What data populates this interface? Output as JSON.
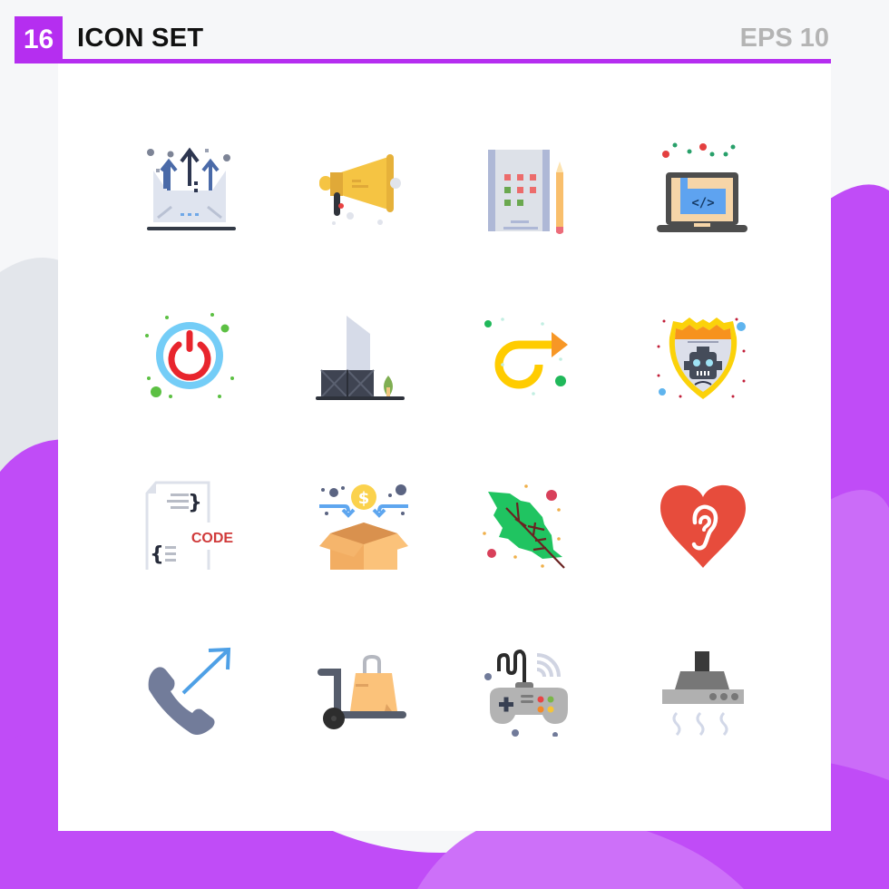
{
  "header": {
    "count": "16",
    "title": "ICON SET",
    "format": "EPS 10"
  },
  "colors": {
    "accent": "#b52ef0",
    "background_blob": "#c04cf7",
    "panel": "#ffffff"
  },
  "icons": [
    {
      "name": "email-upload-arrows",
      "row": 1,
      "col": 1
    },
    {
      "name": "megaphone",
      "row": 1,
      "col": 2
    },
    {
      "name": "sketchbook-pencil",
      "row": 1,
      "col": 3
    },
    {
      "name": "laptop-code",
      "row": 1,
      "col": 4
    },
    {
      "name": "power-button",
      "row": 2,
      "col": 1
    },
    {
      "name": "building-with-leaf",
      "row": 2,
      "col": 2
    },
    {
      "name": "loop-arrow",
      "row": 2,
      "col": 3
    },
    {
      "name": "robot-shield",
      "row": 2,
      "col": 4
    },
    {
      "name": "code-document",
      "row": 3,
      "col": 1,
      "label": "CODE"
    },
    {
      "name": "box-money",
      "row": 3,
      "col": 2,
      "label": "$"
    },
    {
      "name": "leaf",
      "row": 3,
      "col": 3
    },
    {
      "name": "heart-ear",
      "row": 3,
      "col": 4
    },
    {
      "name": "outgoing-call",
      "row": 4,
      "col": 1
    },
    {
      "name": "shopping-trolley",
      "row": 4,
      "col": 2
    },
    {
      "name": "gamepad",
      "row": 4,
      "col": 3
    },
    {
      "name": "kitchen-hood",
      "row": 4,
      "col": 4
    }
  ]
}
